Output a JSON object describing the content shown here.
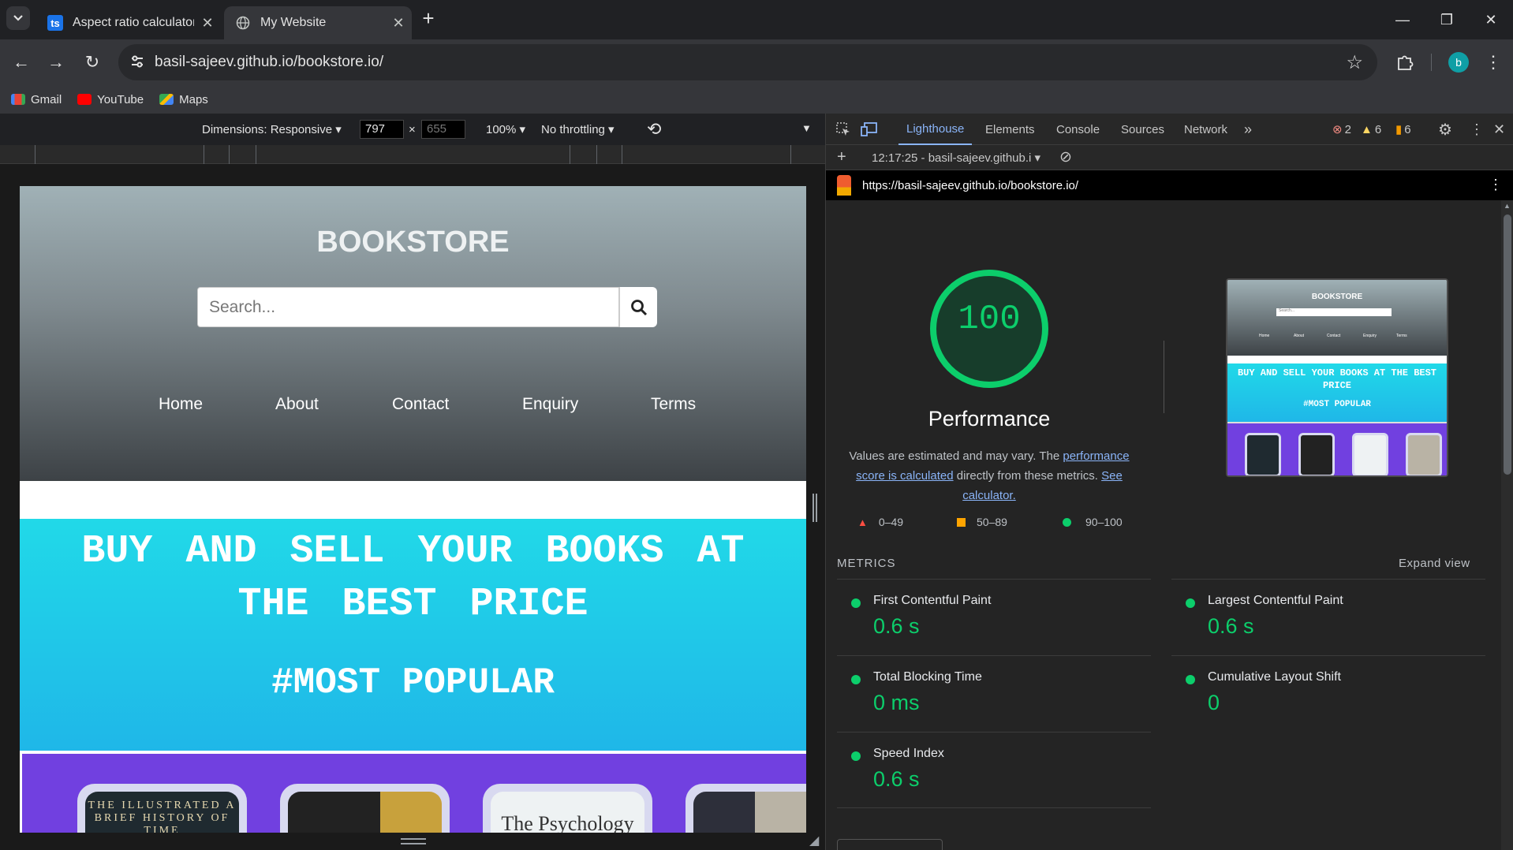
{
  "tabs": [
    {
      "title": "Aspect ratio calculator · toolstu",
      "favicon": "ts"
    },
    {
      "title": "My Website"
    }
  ],
  "address": {
    "url": "basil-sajeev.github.io/bookstore.io/"
  },
  "profile": {
    "initial": "b"
  },
  "bookmarks": [
    {
      "label": "Gmail"
    },
    {
      "label": "YouTube"
    },
    {
      "label": "Maps"
    }
  ],
  "device_toolbar": {
    "dimensions": "Dimensions: Responsive",
    "width": "797",
    "height": "655",
    "zoom": "100%",
    "throttling": "No throttling"
  },
  "site": {
    "brand": "BOOKSTORE",
    "search_placeholder": "Search...",
    "nav": [
      "Home",
      "About",
      "Contact",
      "Enquiry",
      "Terms"
    ],
    "headline": "BUY AND SELL YOUR BOOKS AT THE BEST PRICE",
    "popular": "#MOST POPULAR",
    "book_titles": [
      "THE ILLUSTRATED A BRIEF HISTORY OF TIME",
      "",
      "The Psychology",
      ""
    ]
  },
  "devtools": {
    "tabs": [
      "Lighthouse",
      "Elements",
      "Console",
      "Sources",
      "Network"
    ],
    "errors": "2",
    "warnings": "6",
    "issues": "6",
    "report_time": "12:17:25 - basil-sajeev.github.i",
    "report_url": "https://basil-sajeev.github.io/bookstore.io/",
    "score": "100",
    "category": "Performance",
    "desc_pre": "Values are estimated and may vary. The ",
    "desc_link1": "performance score is calculated",
    "desc_mid": " directly from these metrics. ",
    "desc_link2": "See calculator.",
    "legend": [
      "0–49",
      "50–89",
      "90–100"
    ],
    "metrics_header": "METRICS",
    "expand": "Expand view",
    "metrics": [
      {
        "name": "First Contentful Paint",
        "value": "0.6 s"
      },
      {
        "name": "Largest Contentful Paint",
        "value": "0.6 s"
      },
      {
        "name": "Total Blocking Time",
        "value": "0 ms"
      },
      {
        "name": "Cumulative Layout Shift",
        "value": "0"
      },
      {
        "name": "Speed Index",
        "value": "0.6 s"
      }
    ],
    "thumb": {
      "brand": "BOOKSTORE",
      "search": "Search...",
      "nav": [
        "Home",
        "About",
        "Contact",
        "Enquiry",
        "Terms"
      ],
      "headline": "BUY AND SELL YOUR BOOKS AT THE BEST PRICE",
      "popular": "#MOST POPULAR"
    }
  },
  "colors": {
    "score_green": "#0cce6b",
    "link": "#8ab4f8",
    "cyan": "#21d9e8",
    "purple": "#7140e0"
  }
}
